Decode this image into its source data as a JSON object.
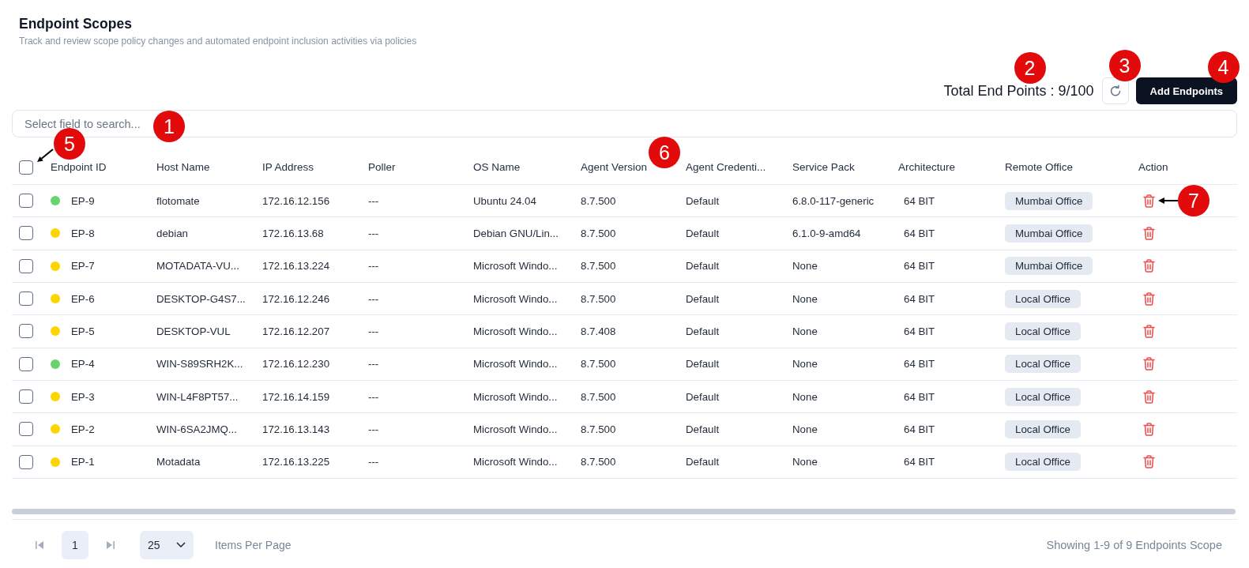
{
  "header": {
    "title": "Endpoint Scopes",
    "subtitle": "Track and review scope policy changes and automated endpoint inclusion activities via policies"
  },
  "toolbar": {
    "total": {
      "text": "Total End Points : 9/100",
      "callout": {
        "number": "2"
      }
    },
    "refresh_button": {
      "callout": {
        "number": "3"
      }
    },
    "add_button": {
      "label": "Add Endpoints",
      "callout": {
        "number": "4"
      }
    }
  },
  "search": {
    "placeholder": "Select field to search...",
    "callout": {
      "number": "1"
    }
  },
  "table": {
    "select_all": {
      "checked": false,
      "callout": {
        "number": "5",
        "arrow": true
      }
    },
    "columns": [
      "Endpoint ID",
      "Host Name",
      "IP Address",
      "Poller",
      "OS Name",
      "Agent Version",
      "Agent Credenti...",
      "Service Pack",
      "Architecture",
      "Remote Office",
      "Action"
    ],
    "columns_callout": {
      "number": "6"
    },
    "rows": [
      {
        "checked": false,
        "color": "#69d36e",
        "cells": [
          "EP-9",
          "flotomate",
          "172.16.12.156",
          "---",
          "Ubuntu 24.04",
          "8.7.500",
          "Default",
          "6.8.0-117-generic",
          "64 BIT"
        ],
        "office": "Mumbai Office",
        "callout": {
          "number": "7",
          "arrow": true
        }
      },
      {
        "checked": false,
        "color": "#fcd500",
        "cells": [
          "EP-8",
          "debian",
          "172.16.13.68",
          "---",
          "Debian GNU/Lin...",
          "8.7.500",
          "Default",
          "6.1.0-9-amd64",
          "64 BIT"
        ],
        "office": "Mumbai Office"
      },
      {
        "checked": false,
        "color": "#fcd500",
        "cells": [
          "EP-7",
          "MOTADATA-VU...",
          "172.16.13.224",
          "---",
          "Microsoft Windo...",
          "8.7.500",
          "Default",
          "None",
          "64 BIT"
        ],
        "office": "Mumbai Office"
      },
      {
        "checked": false,
        "color": "#fcd500",
        "cells": [
          "EP-6",
          "DESKTOP-G4S7...",
          "172.16.12.246",
          "---",
          "Microsoft Windo...",
          "8.7.500",
          "Default",
          "None",
          "64 BIT"
        ],
        "office": "Local Office"
      },
      {
        "checked": false,
        "color": "#fcd500",
        "cells": [
          "EP-5",
          "DESKTOP-VUL",
          "172.16.12.207",
          "---",
          "Microsoft Windo...",
          "8.7.408",
          "Default",
          "None",
          "64 BIT"
        ],
        "office": "Local Office"
      },
      {
        "checked": false,
        "color": "#69d36e",
        "cells": [
          "EP-4",
          "WIN-S89SRH2K...",
          "172.16.12.230",
          "---",
          "Microsoft Windo...",
          "8.7.500",
          "Default",
          "None",
          "64 BIT"
        ],
        "office": "Local Office"
      },
      {
        "checked": false,
        "color": "#fcd500",
        "cells": [
          "EP-3",
          "WIN-L4F8PT57...",
          "172.16.14.159",
          "---",
          "Microsoft Windo...",
          "8.7.500",
          "Default",
          "None",
          "64 BIT"
        ],
        "office": "Local Office"
      },
      {
        "checked": false,
        "color": "#fcd500",
        "cells": [
          "EP-2",
          "WIN-6SA2JMQ...",
          "172.16.13.143",
          "---",
          "Microsoft Windo...",
          "8.7.500",
          "Default",
          "None",
          "64 BIT"
        ],
        "office": "Local Office"
      },
      {
        "checked": false,
        "color": "#fcd500",
        "cells": [
          "EP-1",
          "Motadata",
          "172.16.13.225",
          "---",
          "Microsoft Windo...",
          "8.7.500",
          "Default",
          "None",
          "64 BIT"
        ],
        "office": "Local Office"
      }
    ]
  },
  "pagination": {
    "first_page": {
      "disabled": true
    },
    "pages": [
      {
        "label": "1",
        "selected": true
      }
    ],
    "last_page": {
      "disabled": true
    },
    "page_size": "25",
    "page_size_label": "Items Per Page",
    "summary": "Showing 1-9 of 9 Endpoints Scope"
  }
}
